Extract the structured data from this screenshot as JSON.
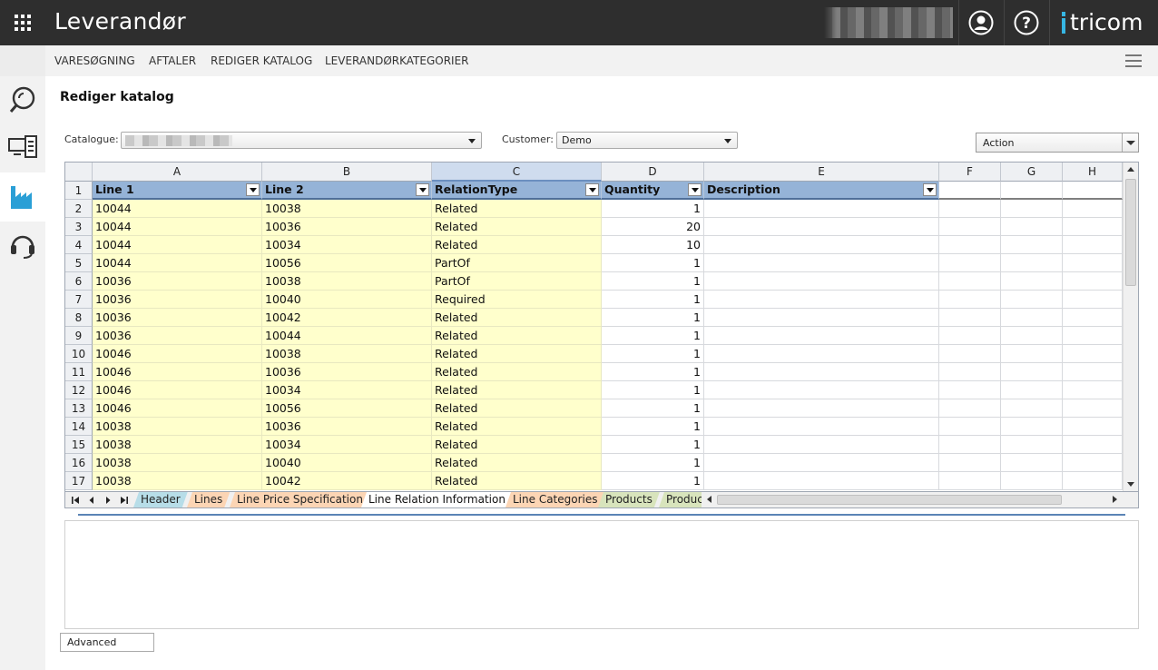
{
  "topbar": {
    "title": "Leverandør",
    "brand": "tricom",
    "icons": [
      "apps-grid-icon",
      "user-icon",
      "help-icon"
    ]
  },
  "menu": {
    "items": [
      "VARESØGNING",
      "AFTALER",
      "REDIGER KATALOG",
      "LEVERANDØRKATEGORIER"
    ]
  },
  "sidebar": {
    "items": [
      "search-icon",
      "catalog-devices-icon",
      "factory-icon",
      "headset-icon"
    ],
    "active_index": 2
  },
  "page": {
    "title": "Rediger katalog",
    "catalogue_label": "Catalogue:",
    "customer_label": "Customer:",
    "customer_value": "Demo",
    "action_value": "Action",
    "advanced_label": "Advanced"
  },
  "sheet": {
    "column_letters": [
      "A",
      "B",
      "C",
      "D",
      "E",
      "F",
      "G",
      "H"
    ],
    "selected_column": "C",
    "headers": [
      "Line 1",
      "Line 2",
      "RelationType",
      "Quantity",
      "Description"
    ],
    "rows": [
      [
        "10044",
        "10038",
        "Related",
        "1",
        ""
      ],
      [
        "10044",
        "10036",
        "Related",
        "20",
        ""
      ],
      [
        "10044",
        "10034",
        "Related",
        "10",
        ""
      ],
      [
        "10044",
        "10056",
        "PartOf",
        "1",
        ""
      ],
      [
        "10036",
        "10038",
        "PartOf",
        "1",
        ""
      ],
      [
        "10036",
        "10040",
        "Required",
        "1",
        ""
      ],
      [
        "10036",
        "10042",
        "Related",
        "1",
        ""
      ],
      [
        "10036",
        "10044",
        "Related",
        "1",
        ""
      ],
      [
        "10046",
        "10038",
        "Related",
        "1",
        ""
      ],
      [
        "10046",
        "10036",
        "Related",
        "1",
        ""
      ],
      [
        "10046",
        "10034",
        "Related",
        "1",
        ""
      ],
      [
        "10046",
        "10056",
        "Related",
        "1",
        ""
      ],
      [
        "10038",
        "10036",
        "Related",
        "1",
        ""
      ],
      [
        "10038",
        "10034",
        "Related",
        "1",
        ""
      ],
      [
        "10038",
        "10040",
        "Related",
        "1",
        ""
      ],
      [
        "10038",
        "10042",
        "Related",
        "1",
        ""
      ]
    ],
    "row_numbers": [
      "1",
      "2",
      "3",
      "4",
      "5",
      "6",
      "7",
      "8",
      "9",
      "10",
      "11",
      "12",
      "13",
      "14",
      "15",
      "16",
      "17"
    ],
    "tabs": [
      {
        "label": "Header",
        "color": "#b7dde8"
      },
      {
        "label": "Lines",
        "color": "#fcd5b4"
      },
      {
        "label": "Line Price Specification",
        "color": "#fcd5b4"
      },
      {
        "label": "Line Relation Information",
        "color": "#ffffff"
      },
      {
        "label": "Line Categories",
        "color": "#fcd5b4"
      },
      {
        "label": "Products",
        "color": "#d8e4bc"
      },
      {
        "label": "Produc",
        "color": "#d8e4bc"
      }
    ],
    "active_tab": "Line Relation Information"
  }
}
